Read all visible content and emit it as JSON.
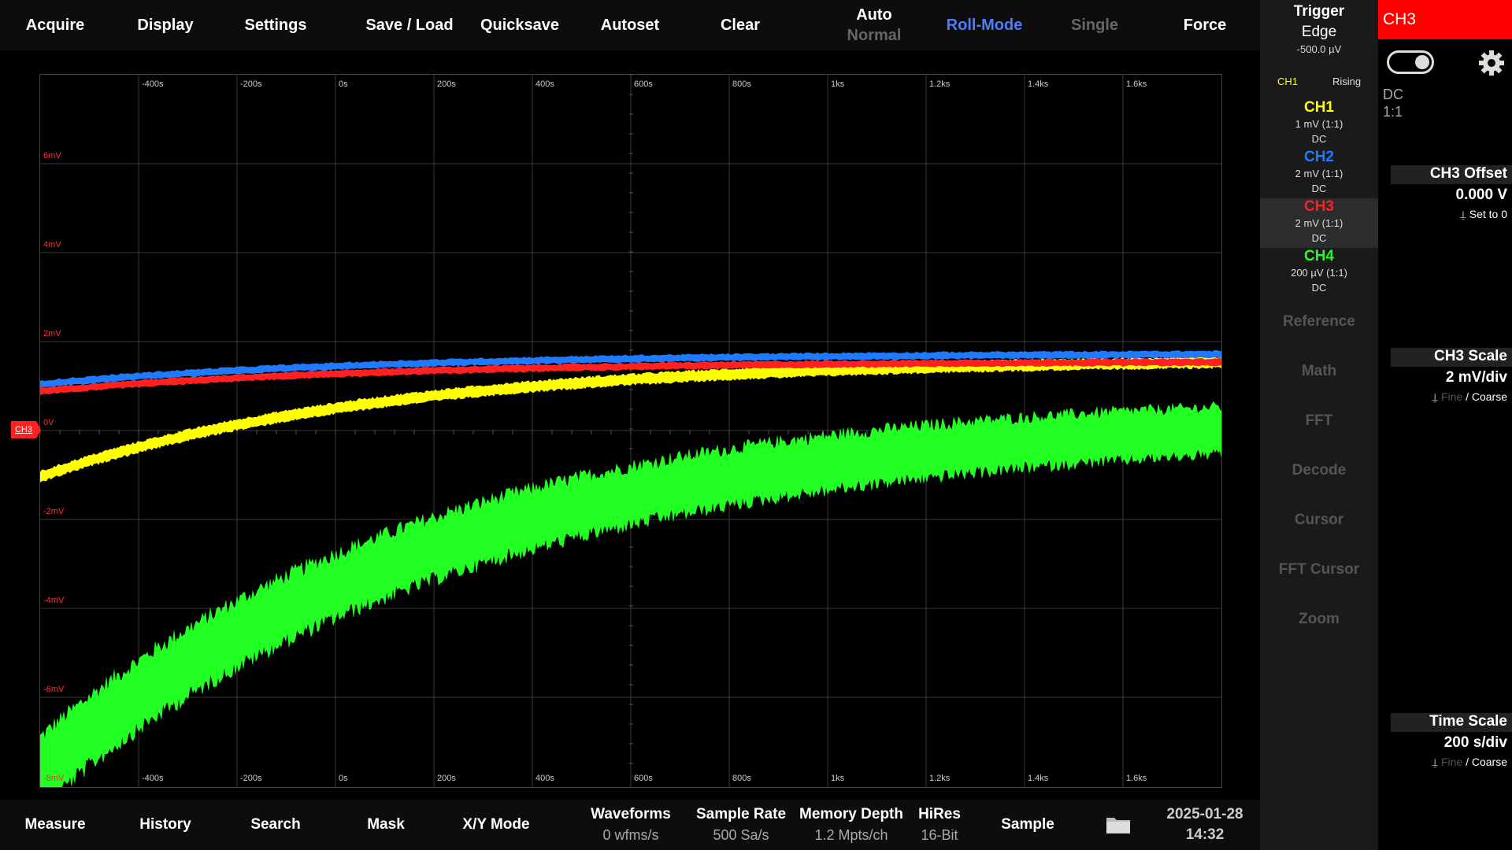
{
  "topbar": {
    "acquire": "Acquire",
    "display": "Display",
    "settings": "Settings",
    "save_load": "Save / Load",
    "quicksave": "Quicksave",
    "autoset": "Autoset",
    "clear": "Clear",
    "auto": "Auto",
    "normal": "Normal",
    "roll_mode": "Roll-Mode",
    "single": "Single",
    "force": "Force"
  },
  "plot": {
    "x_ticks": [
      "-400s",
      "-200s",
      "0s",
      "200s",
      "400s",
      "600s",
      "800s",
      "1ks",
      "1.2ks",
      "1.4ks",
      "1.6ks"
    ],
    "y_ticks": [
      "6mV",
      "4mV",
      "2mV",
      "0V",
      "-2mV",
      "-4mV",
      "-6mV",
      "-8mV"
    ],
    "ch3_marker": "CH3",
    "trace_colors": {
      "ch1": "#ffff00",
      "ch2": "#1e7bff",
      "ch3": "#ff2020",
      "ch4": "#22ff22"
    },
    "grid_color": "#3a3a3a",
    "axis_label_color": "#ff3030"
  },
  "trigger": {
    "title": "Trigger",
    "type": "Edge",
    "level": "-500.0 µV",
    "source": "CH1",
    "slope": "Rising"
  },
  "channels": [
    {
      "name": "CH1",
      "scale": "1 mV (1:1)",
      "coupling": "DC",
      "color": "#ffff00"
    },
    {
      "name": "CH2",
      "scale": "2 mV (1:1)",
      "coupling": "DC",
      "color": "#1e7bff"
    },
    {
      "name": "CH3",
      "scale": "2 mV (1:1)",
      "coupling": "DC",
      "color": "#ff2020"
    },
    {
      "name": "CH4",
      "scale": "200 µV (1:1)",
      "coupling": "DC",
      "color": "#22ff22"
    }
  ],
  "menu": {
    "reference": "Reference",
    "math": "Math",
    "fft": "FFT",
    "decode": "Decode",
    "cursor": "Cursor",
    "fft_cursor": "FFT Cursor",
    "zoom": "Zoom"
  },
  "ch3_panel": {
    "title": "CH3",
    "coupling": "DC",
    "ratio": "1:1",
    "enabled": true,
    "offset_label": "CH3 Offset",
    "offset_value": "0.000 V",
    "offset_action": "Set to 0",
    "scale_label": "CH3 Scale",
    "scale_value": "2 mV/div",
    "fine": "Fine",
    "sep": " / ",
    "coarse": "Coarse",
    "time_label": "Time Scale",
    "time_value": "200 s/div",
    "time_fine": "Fine",
    "time_coarse": "Coarse"
  },
  "bottombar": {
    "measure": "Measure",
    "history": "History",
    "search": "Search",
    "mask": "Mask",
    "xy_mode": "X/Y Mode",
    "waveforms_label": "Waveforms",
    "waveforms_value": "0 wfms/s",
    "sample_rate_label": "Sample Rate",
    "sample_rate_value": "500 Sa/s",
    "memory_depth_label": "Memory Depth",
    "memory_depth_value": "1.2 Mpts/ch",
    "hires_label": "HiRes",
    "hires_value": "16-Bit",
    "sample": "Sample",
    "date": "2025-01-28",
    "time": "14:32"
  }
}
